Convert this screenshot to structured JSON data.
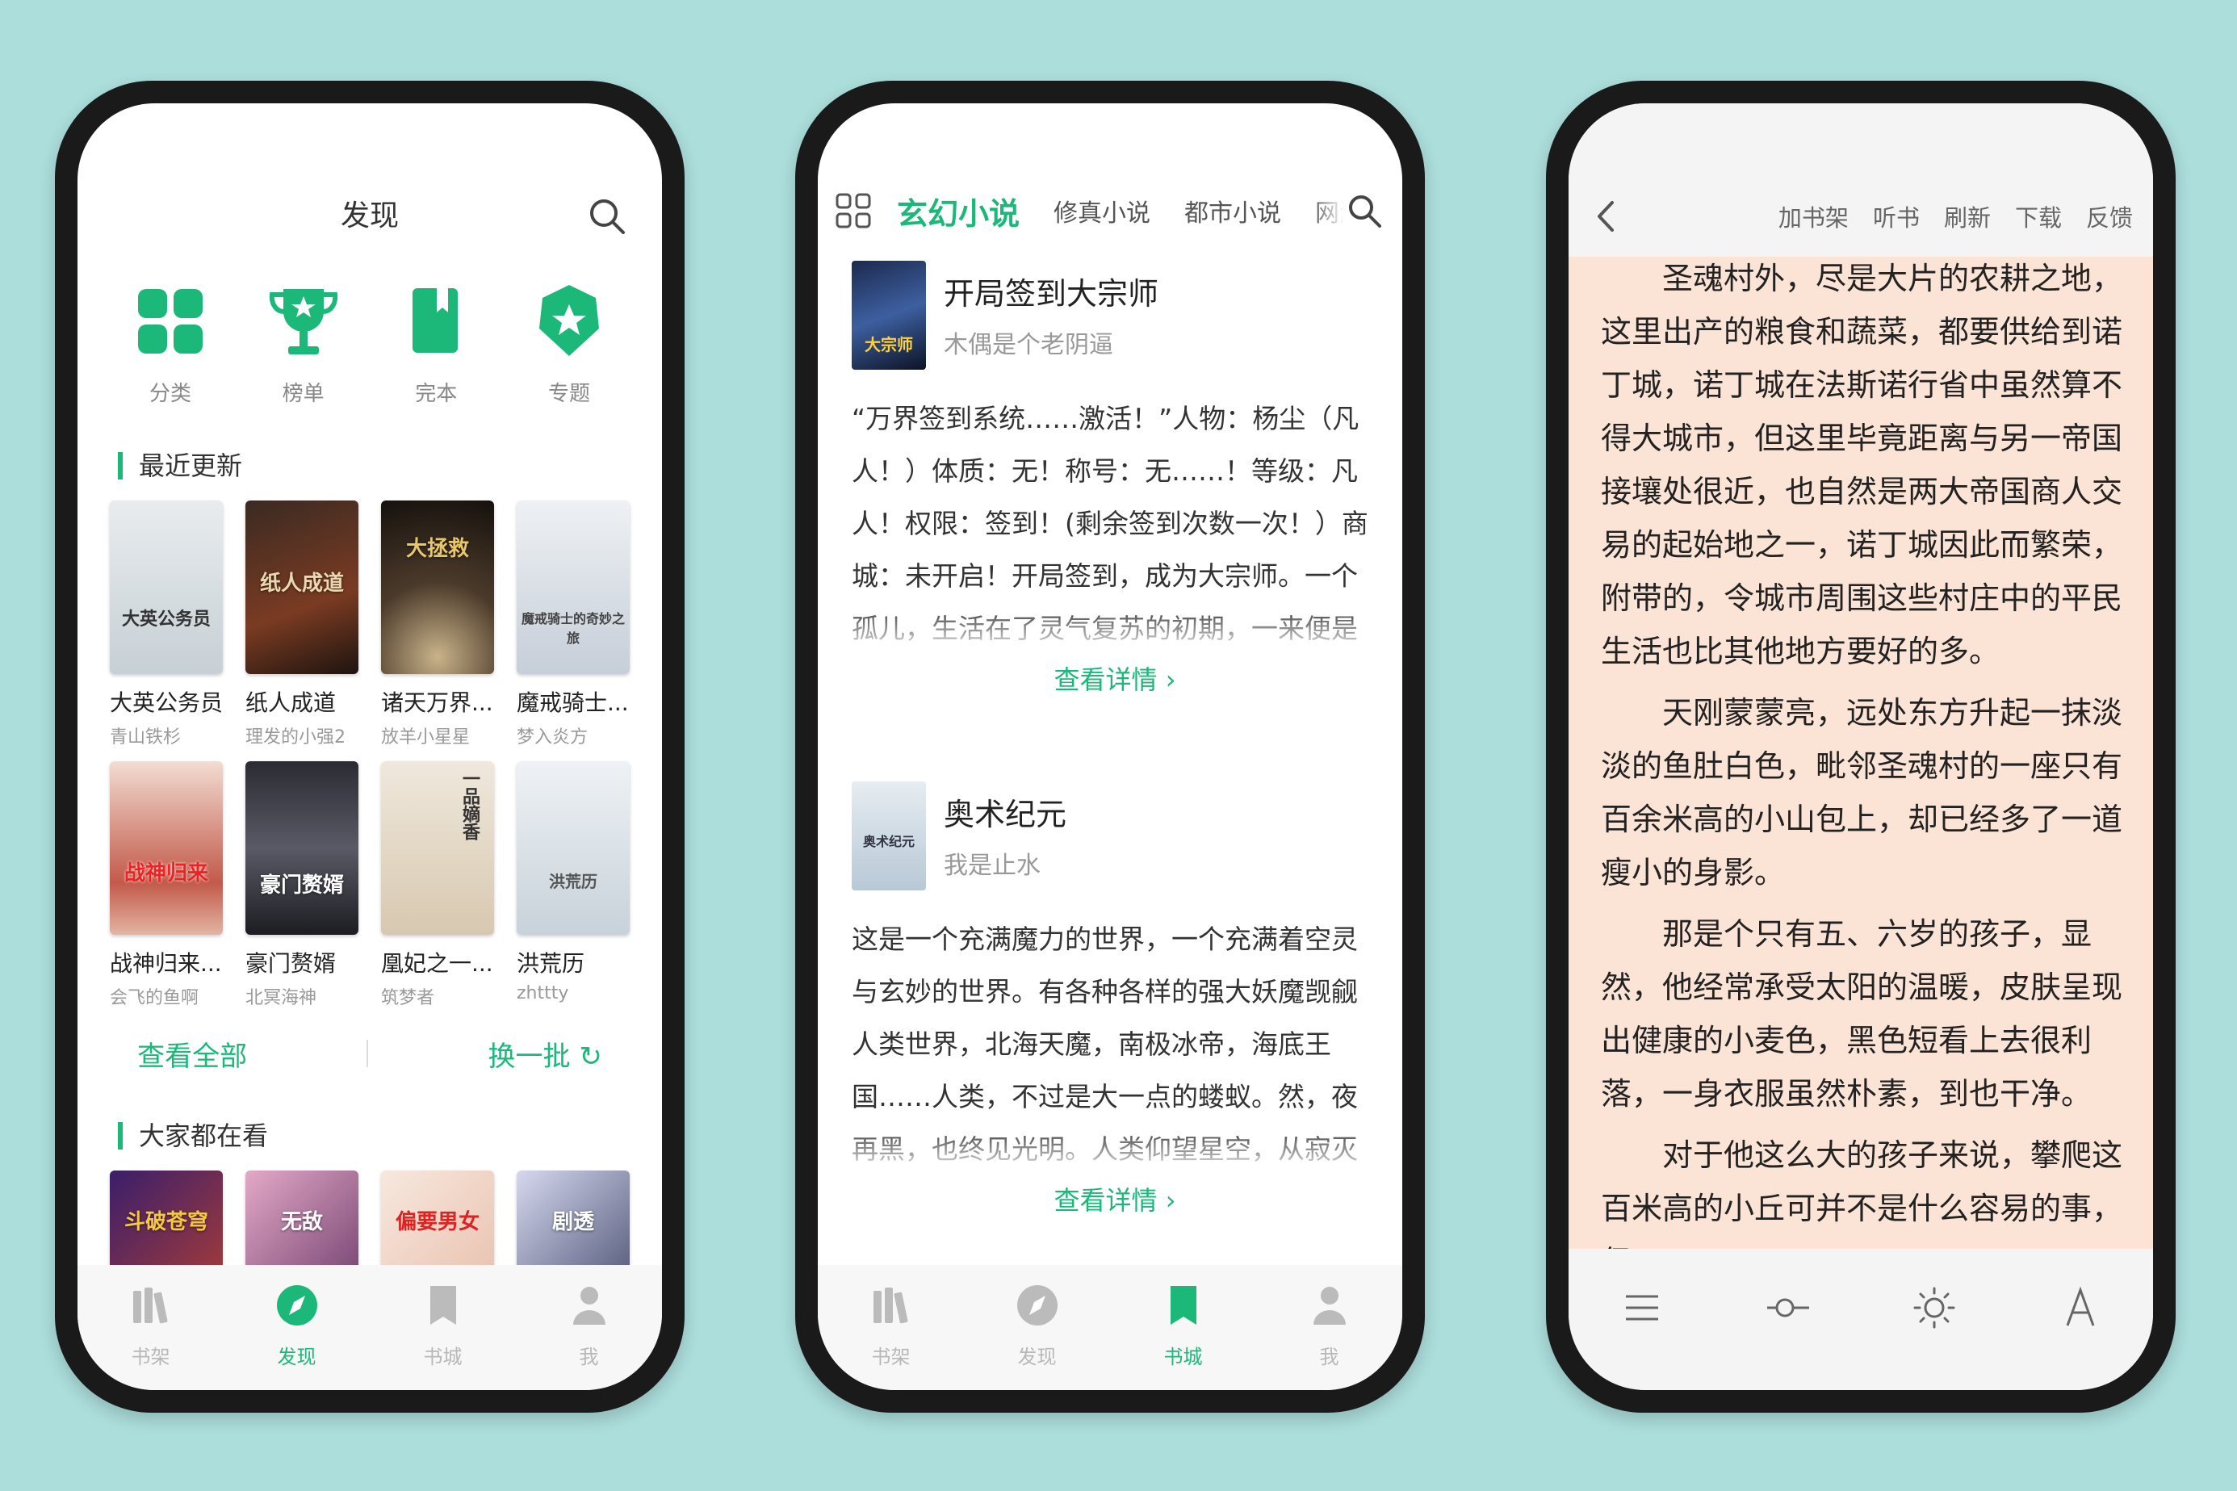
{
  "colors": {
    "accent": "#1bb87a",
    "background": "#acdedc",
    "reader_bg": "#fbe4d5"
  },
  "phone1": {
    "title": "发现",
    "search_icon": "search-icon",
    "quick": [
      {
        "label": "分类",
        "icon": "grid-icon"
      },
      {
        "label": "榜单",
        "icon": "trophy-icon"
      },
      {
        "label": "完本",
        "icon": "bookmark-book-icon"
      },
      {
        "label": "专题",
        "icon": "star-badge-icon"
      }
    ],
    "recent_title": "最近更新",
    "recent_books": [
      {
        "title": "大英公务员",
        "author": "青山铁杉",
        "cover_text": "大英公务员"
      },
      {
        "title": "纸人成道",
        "author": "理发的小强2",
        "cover_text": "纸人成道"
      },
      {
        "title": "诸天万界...",
        "author": "放羊小星星",
        "cover_text": "大拯救"
      },
      {
        "title": "魔戒骑士...",
        "author": "梦入炎方",
        "cover_text": "魔戒骑士的奇妙之旅"
      },
      {
        "title": "战神归来...",
        "author": "会飞的鱼啊",
        "cover_text": "战神归来"
      },
      {
        "title": "豪门赘婿",
        "author": "北冥海神",
        "cover_text": "豪门赘婿"
      },
      {
        "title": "凰妃之一...",
        "author": "筑梦者",
        "cover_text": "一品嫡香"
      },
      {
        "title": "洪荒历",
        "author": "zhttty",
        "cover_text": "洪荒历"
      }
    ],
    "view_all": "查看全部",
    "refresh": "换一批",
    "popular_title": "大家都在看",
    "popular_covers": [
      "斗破苍穹",
      "无敌",
      "偏要男女",
      "剧透"
    ]
  },
  "tabs": [
    {
      "label": "书架",
      "icon": "bookshelf-icon"
    },
    {
      "label": "发现",
      "icon": "compass-icon"
    },
    {
      "label": "书城",
      "icon": "bookmark-icon"
    },
    {
      "label": "我",
      "icon": "user-icon"
    }
  ],
  "phone2": {
    "categories": [
      "玄幻小说",
      "修真小说",
      "都市小说",
      "网游"
    ],
    "books": [
      {
        "title": "开局签到大宗师",
        "author": "木偶是个老阴逼",
        "cover_text": "大宗师",
        "description": "“万界签到系统……激活！”人物：杨尘（凡人！）体质：无！称号：无……！等级：凡人！权限：签到！(剩余签到次数一次！）商城：未开启！开局签到，成为大宗师。一个孤儿，生活在了灵气复苏的初期，一来便是拥有了无上的实力，且看他，如何在灵气复苏的洪流"
      },
      {
        "title": "奥术纪元",
        "author": "我是止水",
        "cover_text": "奥术纪元",
        "description": "这是一个充满魔力的世界，一个充满着空灵与玄妙的世界。有各种各样的强大妖魔觊觎人类世界，北海天魔，南极冰帝，海底王国……人类，不过是大一点的蝼蚁。然，夜再黑，也终见光明。人类仰望星空，从寂灭中寻找生机，终于在某个孤独的夜晚，仰望星空的时"
      }
    ],
    "detail_link": "查看详情"
  },
  "phone3": {
    "actions": [
      "加书架",
      "听书",
      "刷新",
      "下载",
      "反馈"
    ],
    "paragraphs": [
      "圣魂村外，尽是大片的农耕之地，这里出产的粮食和蔬菜，都要供给到诺丁城，诺丁城在法斯诺行省中虽然算不得大城市，但这里毕竟距离与另一帝国接壤处很近，也自然是两大帝国商人交易的起始地之一，诺丁城因此而繁荣，附带的，令城市周围这些村庄中的平民生活也比其他地方要好的多。",
      "天刚蒙蒙亮，远处东方升起一抹淡淡的鱼肚白色，毗邻圣魂村的一座只有百余米高的小山包上，却已经多了一道瘦小的身影。",
      "那是个只有五、六岁的孩子，显然，他经常承受太阳的温暖，皮肤呈现出健康的小麦色，黑色短看上去很利落，一身衣服虽然朴素，到也干净。",
      "对于他这么大的孩子来说，攀爬这百米高的小丘可并不是什么容易的事，但"
    ],
    "bottom_icons": [
      "menu-icon",
      "progress-icon",
      "brightness-icon",
      "font-icon"
    ]
  }
}
